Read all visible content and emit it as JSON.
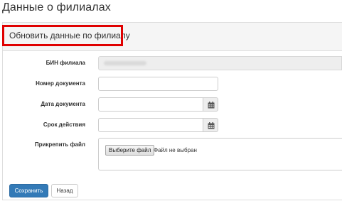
{
  "page": {
    "title": "Данные о филиалах"
  },
  "panel": {
    "title": "Обновить данные по филиалу"
  },
  "form": {
    "bin_label": "БИН филиала",
    "doc_number_label": "Номер документа",
    "doc_date_label": "Дата документа",
    "validity_label": "Срок действия",
    "attach_label": "Прикрепить файл",
    "choose_file_label": "Выберите файл",
    "file_status": "Файл не выбран"
  },
  "actions": {
    "save_label": "Сохранить",
    "back_label": "Назад"
  },
  "icons": {
    "calendar": "calendar-icon"
  },
  "colors": {
    "primary": "#337ab7",
    "highlight": "#e00000",
    "readonly_bg": "#eeeeee"
  }
}
